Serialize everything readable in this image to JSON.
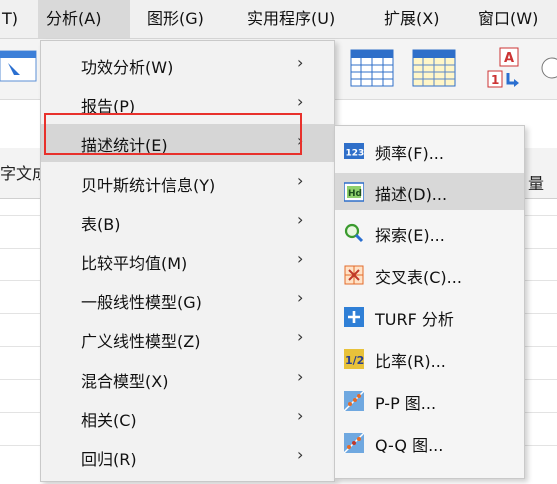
{
  "menubar": {
    "items": [
      {
        "label": "T)"
      },
      {
        "label": "分析(A)"
      },
      {
        "label": "图形(G)"
      },
      {
        "label": "实用程序(U)"
      },
      {
        "label": "扩展(X)"
      },
      {
        "label": "窗口(W)"
      }
    ]
  },
  "background": {
    "col_left": "字文成",
    "col_right": "量"
  },
  "analyze_menu": {
    "items": [
      {
        "label": "功效分析(W)"
      },
      {
        "label": "报告(P)"
      },
      {
        "label": "描述统计(E)"
      },
      {
        "label": "贝叶斯统计信息(Y)"
      },
      {
        "label": "表(B)"
      },
      {
        "label": "比较平均值(M)"
      },
      {
        "label": "一般线性模型(G)"
      },
      {
        "label": "广义线性模型(Z)"
      },
      {
        "label": "混合模型(X)"
      },
      {
        "label": "相关(C)"
      },
      {
        "label": "回归(R)"
      }
    ],
    "arrow": "›",
    "highlighted_index": 2,
    "highlight_color": "#e8312c"
  },
  "descriptive_submenu": {
    "items": [
      {
        "label": "频率(F)...",
        "icon": "frequencies-icon"
      },
      {
        "label": "描述(D)...",
        "icon": "descriptives-icon"
      },
      {
        "label": "探索(E)...",
        "icon": "explore-icon"
      },
      {
        "label": "交叉表(C)...",
        "icon": "crosstabs-icon"
      },
      {
        "label": "TURF 分析",
        "icon": "turf-icon"
      },
      {
        "label": "比率(R)...",
        "icon": "ratio-icon"
      },
      {
        "label": "P-P 图...",
        "icon": "pp-plot-icon"
      },
      {
        "label": "Q-Q 图...",
        "icon": "qq-plot-icon"
      }
    ],
    "hovered_index": 1
  }
}
